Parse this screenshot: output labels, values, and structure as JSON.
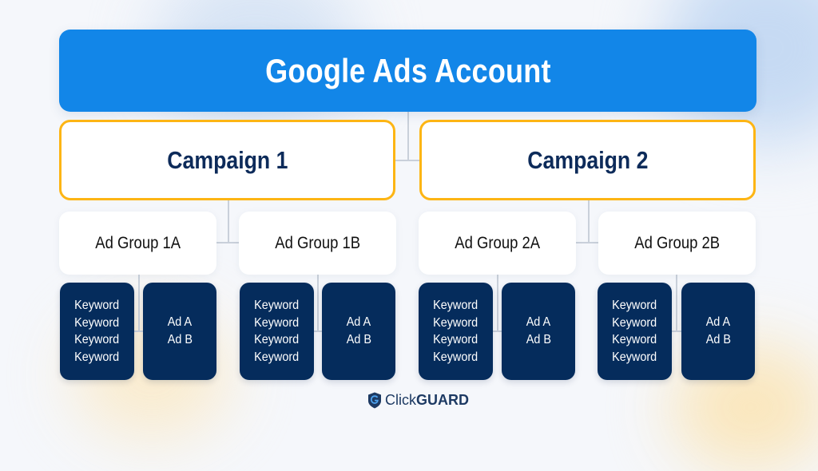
{
  "account": {
    "label": "Google Ads Account"
  },
  "campaigns": [
    {
      "label": "Campaign 1",
      "ad_groups": [
        {
          "label": "Ad Group 1A",
          "keywords": [
            "Keyword",
            "Keyword",
            "Keyword",
            "Keyword"
          ],
          "ads": [
            "Ad A",
            "Ad B"
          ]
        },
        {
          "label": "Ad Group 1B",
          "keywords": [
            "Keyword",
            "Keyword",
            "Keyword",
            "Keyword"
          ],
          "ads": [
            "Ad A",
            "Ad B"
          ]
        }
      ]
    },
    {
      "label": "Campaign 2",
      "ad_groups": [
        {
          "label": "Ad Group 2A",
          "keywords": [
            "Keyword",
            "Keyword",
            "Keyword",
            "Keyword"
          ],
          "ads": [
            "Ad A",
            "Ad B"
          ]
        },
        {
          "label": "Ad Group 2B",
          "keywords": [
            "Keyword",
            "Keyword",
            "Keyword",
            "Keyword"
          ],
          "ads": [
            "Ad A",
            "Ad B"
          ]
        }
      ]
    }
  ],
  "logo": {
    "brand_light": "Click",
    "brand_bold": "GUARD",
    "icon": "shield-g-icon"
  },
  "colors": {
    "account": "#1286e8",
    "campaign_border": "#fdb514",
    "campaign_text": "#0d2b5a",
    "leaf_bg": "#052c5c",
    "background": "#f5f7fb"
  }
}
